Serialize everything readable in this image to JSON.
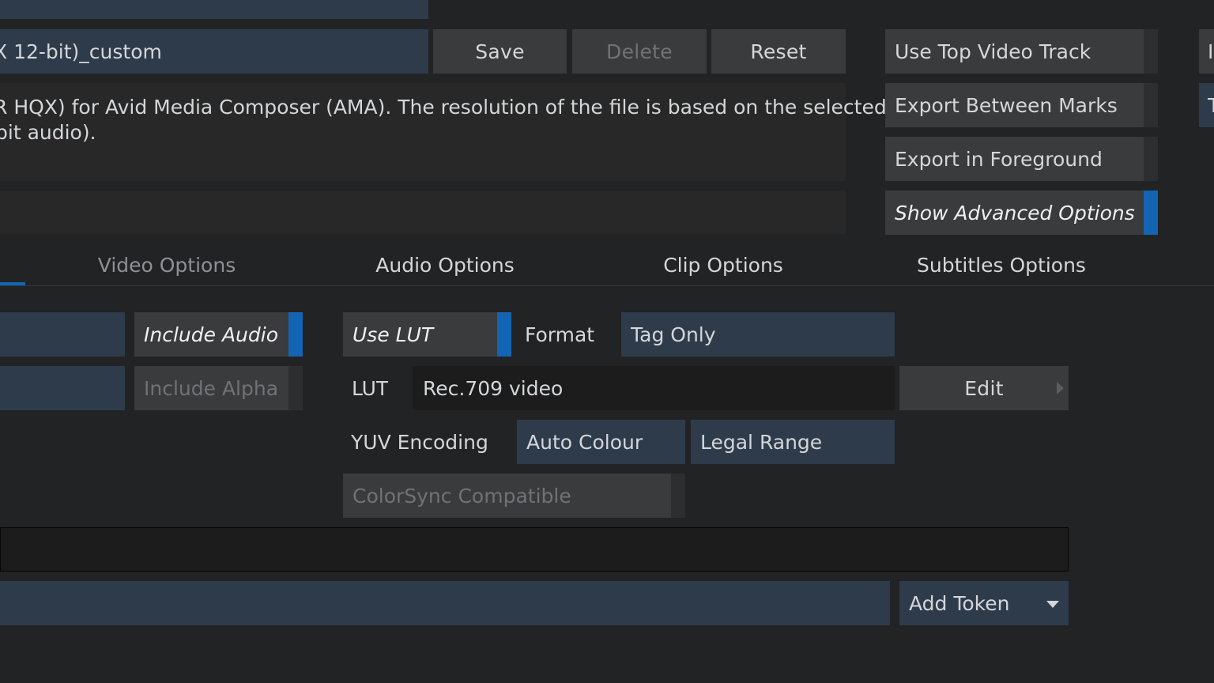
{
  "preset": {
    "name_value": "X 12-bit)_custom",
    "save_label": "Save",
    "delete_label": "Delete",
    "reset_label": "Reset",
    "description_line1": "R HQX) for Avid Media Composer (AMA).  The resolution of the file is based on the selected",
    "description_line2": "bit audio)."
  },
  "right_toggles": [
    {
      "label": "Use Top Video Track",
      "on": false
    },
    {
      "label": "Export Between Marks",
      "on": false
    },
    {
      "label": "Export in Foreground",
      "on": false
    },
    {
      "label": "Show Advanced Options",
      "on": true
    }
  ],
  "edge_cut": {
    "top": "I",
    "second": "T"
  },
  "tabs": [
    {
      "label": "Video Options",
      "active": false
    },
    {
      "label": "Audio Options",
      "active": false
    },
    {
      "label": "Clip Options",
      "active": false
    },
    {
      "label": "Subtitles Options",
      "active": false
    }
  ],
  "video": {
    "include_audio_label": "Include Audio",
    "include_alpha_label": "Include Alpha",
    "use_lut_label": "Use LUT",
    "format_label": "Format",
    "format_value": "Tag Only",
    "lut_label": "LUT",
    "lut_value": "Rec.709 video",
    "edit_label": "Edit",
    "yuv_label": "YUV Encoding",
    "yuv_value": "Auto Colour",
    "range_value": "Legal Range",
    "colorsync_label": "ColorSync Compatible"
  },
  "output": {
    "add_token_label": "Add Token"
  },
  "colors": {
    "background": "#222324",
    "accent": "#1464b4",
    "field": "#2e3b4b",
    "button": "#3a3b3c"
  }
}
